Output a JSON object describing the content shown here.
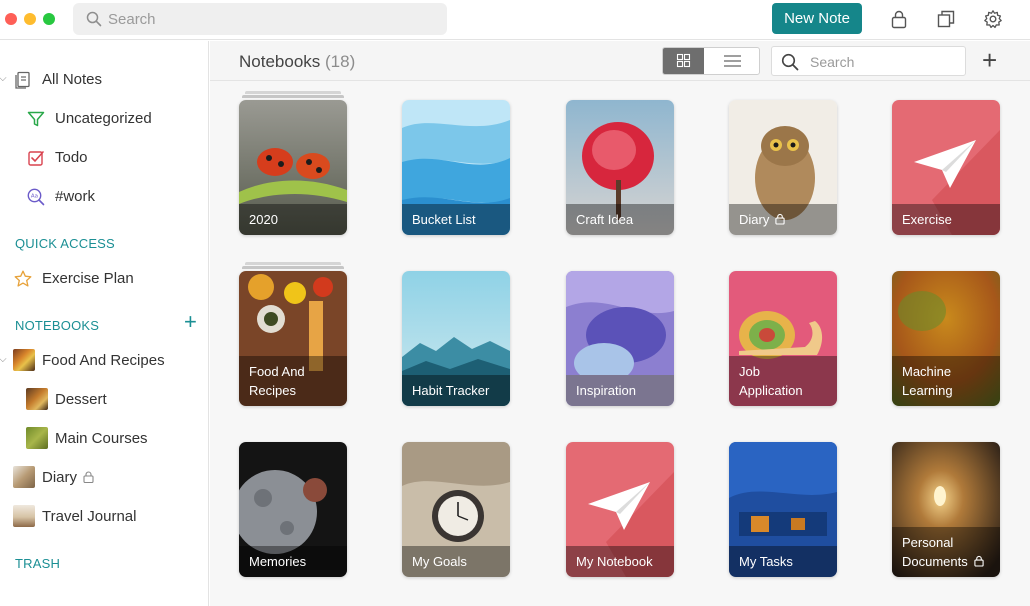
{
  "topbar": {
    "search_placeholder": "Search",
    "new_note_label": "New Note",
    "icons": [
      "lock-icon",
      "duplicate-window-icon",
      "gear-icon"
    ]
  },
  "sidebar": {
    "all_notes": "All Notes",
    "uncategorized": "Uncategorized",
    "todo": "Todo",
    "work_tag": "#work",
    "quick_access_heading": "QUICK ACCESS",
    "exercise_plan": "Exercise Plan",
    "notebooks_heading": "NOTEBOOKS",
    "food_and_recipes": "Food And Recipes",
    "dessert": "Dessert",
    "main_courses": "Main Courses",
    "diary": "Diary",
    "travel_journal": "Travel Journal",
    "trash_heading": "TRASH",
    "accent_color": "#1b8f94"
  },
  "main": {
    "title": "Notebooks",
    "count": "(18)",
    "search_placeholder": "Search",
    "view_mode": "grid",
    "notebooks": [
      {
        "line1": "2020",
        "line2": "",
        "locked": false
      },
      {
        "line1": "Bucket List",
        "line2": "",
        "locked": false
      },
      {
        "line1": "Craft Idea",
        "line2": "",
        "locked": false
      },
      {
        "line1": "Diary",
        "line2": "",
        "locked": true
      },
      {
        "line1": "Exercise",
        "line2": "",
        "locked": false
      },
      {
        "line1": "Food And",
        "line2": "Recipes",
        "locked": false
      },
      {
        "line1": "Habit Tracker",
        "line2": "",
        "locked": false
      },
      {
        "line1": "Inspiration",
        "line2": "",
        "locked": false
      },
      {
        "line1": "Job",
        "line2": "Application",
        "locked": false
      },
      {
        "line1": "Machine",
        "line2": "Learning",
        "locked": false
      },
      {
        "line1": "Memories",
        "line2": "",
        "locked": false
      },
      {
        "line1": "My Goals",
        "line2": "",
        "locked": false
      },
      {
        "line1": "My Notebook",
        "line2": "",
        "locked": false
      },
      {
        "line1": "My Tasks",
        "line2": "",
        "locked": false
      },
      {
        "line1": "Personal",
        "line2": "Documents",
        "locked": true
      }
    ]
  }
}
